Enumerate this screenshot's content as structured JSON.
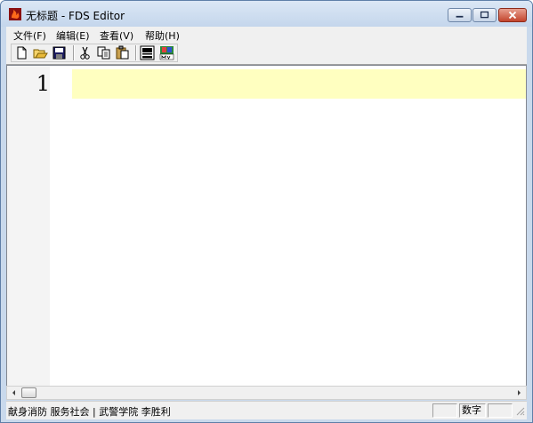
{
  "window": {
    "title": "无标题 - FDS Editor"
  },
  "menu": {
    "items": [
      {
        "label": "文件(F)"
      },
      {
        "label": "编辑(E)"
      },
      {
        "label": "查看(V)"
      },
      {
        "label": "帮助(H)"
      }
    ]
  },
  "toolbar": {
    "buttons": [
      {
        "icon": "new-file-icon"
      },
      {
        "icon": "open-folder-icon"
      },
      {
        "icon": "save-icon"
      },
      {
        "icon": "cut-icon"
      },
      {
        "icon": "copy-icon"
      },
      {
        "icon": "paste-icon"
      },
      {
        "icon": "fds-icon"
      },
      {
        "icon": "smv-icon"
      }
    ]
  },
  "editor": {
    "line_numbers": [
      "1"
    ],
    "current_line_color": "#ffffc0"
  },
  "statusbar": {
    "text": "献身消防 服务社会 | 武警学院 李胜利",
    "panes": [
      "",
      "数字",
      ""
    ]
  },
  "colors": {
    "close_button": "#c3442c",
    "titlebar": "#c4d6ec"
  }
}
